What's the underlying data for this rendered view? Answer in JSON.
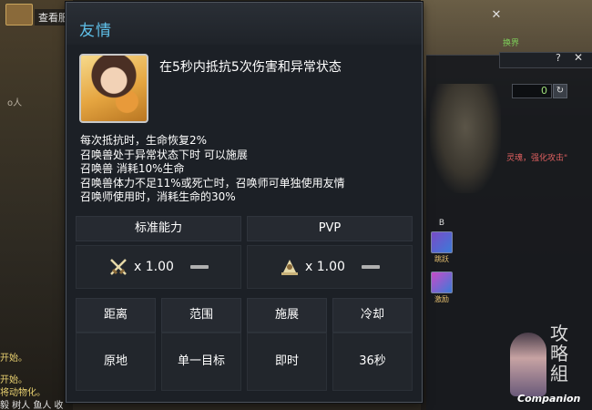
{
  "background": {
    "left_window_title": "查看服",
    "left_log_lines": [
      "开始。",
      "开始。",
      "将动物化。"
    ],
    "left_bottom_text": "毅  树人  鱼人  收",
    "left_side_text": "o人",
    "right_counter_value": "0",
    "right_status_text": "灵魂，强化攻击\"",
    "right_green_text": "换界",
    "right_skill_column_header": "B",
    "right_skill_labels": [
      "跳跃",
      "激励"
    ],
    "companion_text": "Companion",
    "companion_calligraphy": "攻略組"
  },
  "dialog": {
    "title": "友情",
    "headline": "在5秒内抵抗5次伤害和异常状态",
    "description": [
      "每次抵抗时，生命恢复2%",
      "召唤兽处于异常状态下时 可以施展",
      "召唤兽 消耗10%生命",
      "召唤兽体力不足11%或死亡时，召唤师可单独使用友情",
      "召唤师使用时，消耗生命的30%"
    ],
    "ability": {
      "headers": [
        "标准能力",
        "PVP"
      ],
      "values": [
        {
          "icon": "crossed-swords-icon",
          "multiplier": "x 1.00"
        },
        {
          "icon": "bell-pvp-icon",
          "multiplier": "x 1.00"
        }
      ]
    },
    "stats": {
      "headers": [
        "距离",
        "范围",
        "施展",
        "冷却"
      ],
      "values": [
        "原地",
        "单一目标",
        "即时",
        "36秒"
      ]
    }
  },
  "icons": {
    "close": "close-icon",
    "skill": "skill-portrait-icon",
    "reset": "reset-icon"
  },
  "colors": {
    "title_accent": "#5fc1ea",
    "dialog_bg": "#1c2026"
  }
}
